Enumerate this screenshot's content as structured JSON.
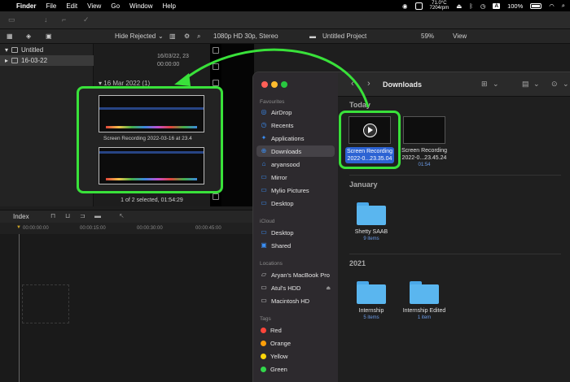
{
  "menubar": {
    "app": "Finder",
    "items": [
      "File",
      "Edit",
      "View",
      "Go",
      "Window",
      "Help"
    ],
    "weather_temp": "71.0°C",
    "weather_rpm": "7204rpm",
    "input_letter": "A",
    "battery": "100%"
  },
  "fcp": {
    "filter": "Hide Rejected",
    "format": "1080p HD 30p, Stereo",
    "project": "Untitled Project",
    "zoom": "59%",
    "view": "View",
    "library": "Untitled",
    "event": "16-03-22",
    "clip_meta_date": "16/03/22, 23",
    "clip_meta_time": "00:00:00",
    "date_header": "16 Mar 2022",
    "date_count": "(1)",
    "clip_name": "Screen Recording 2022-03-16 at 23.4",
    "selection_status": "1 of 2 selected, 01:54:29",
    "index_label": "Index",
    "ruler": [
      "00:00:00:00",
      "00:00:15:00",
      "00:00:30:00",
      "00:00:45:00"
    ]
  },
  "finder": {
    "title": "Downloads",
    "sections": {
      "favourites": "Favourites",
      "icloud": "iCloud",
      "locations": "Locations",
      "tags": "Tags"
    },
    "favourites": [
      "AirDrop",
      "Recents",
      "Applications",
      "Downloads",
      "aryansood",
      "Mirror",
      "Mylio Pictures",
      "Desktop"
    ],
    "icloud": [
      "Desktop",
      "Shared"
    ],
    "locations": [
      "Aryan's MacBook Pro",
      "Atul's HDD",
      "Macintosh HD"
    ],
    "tags": [
      {
        "name": "Red",
        "color": "#ff453a"
      },
      {
        "name": "Orange",
        "color": "#ff9f0a"
      },
      {
        "name": "Yellow",
        "color": "#ffd60a"
      },
      {
        "name": "Green",
        "color": "#32d74b"
      }
    ],
    "groups": {
      "today": "Today",
      "january": "January",
      "y2021": "2021"
    },
    "files_today": [
      {
        "name1": "Screen Recording",
        "name2": "2022-0...23.35.04",
        "sub": ""
      },
      {
        "name1": "Screen Recording",
        "name2": "2022-0...23.45.24",
        "sub": "01:54"
      }
    ],
    "folders_january": [
      {
        "name": "Shetty SAAB",
        "sub": "9 items"
      }
    ],
    "folders_2021": [
      {
        "name": "Internship",
        "sub": "5 items"
      },
      {
        "name": "Internship Edited",
        "sub": "1 item"
      }
    ]
  },
  "colors": {
    "highlight": "#39e13a",
    "selection": "#2c63d3",
    "folder": "#5ab6ef"
  }
}
